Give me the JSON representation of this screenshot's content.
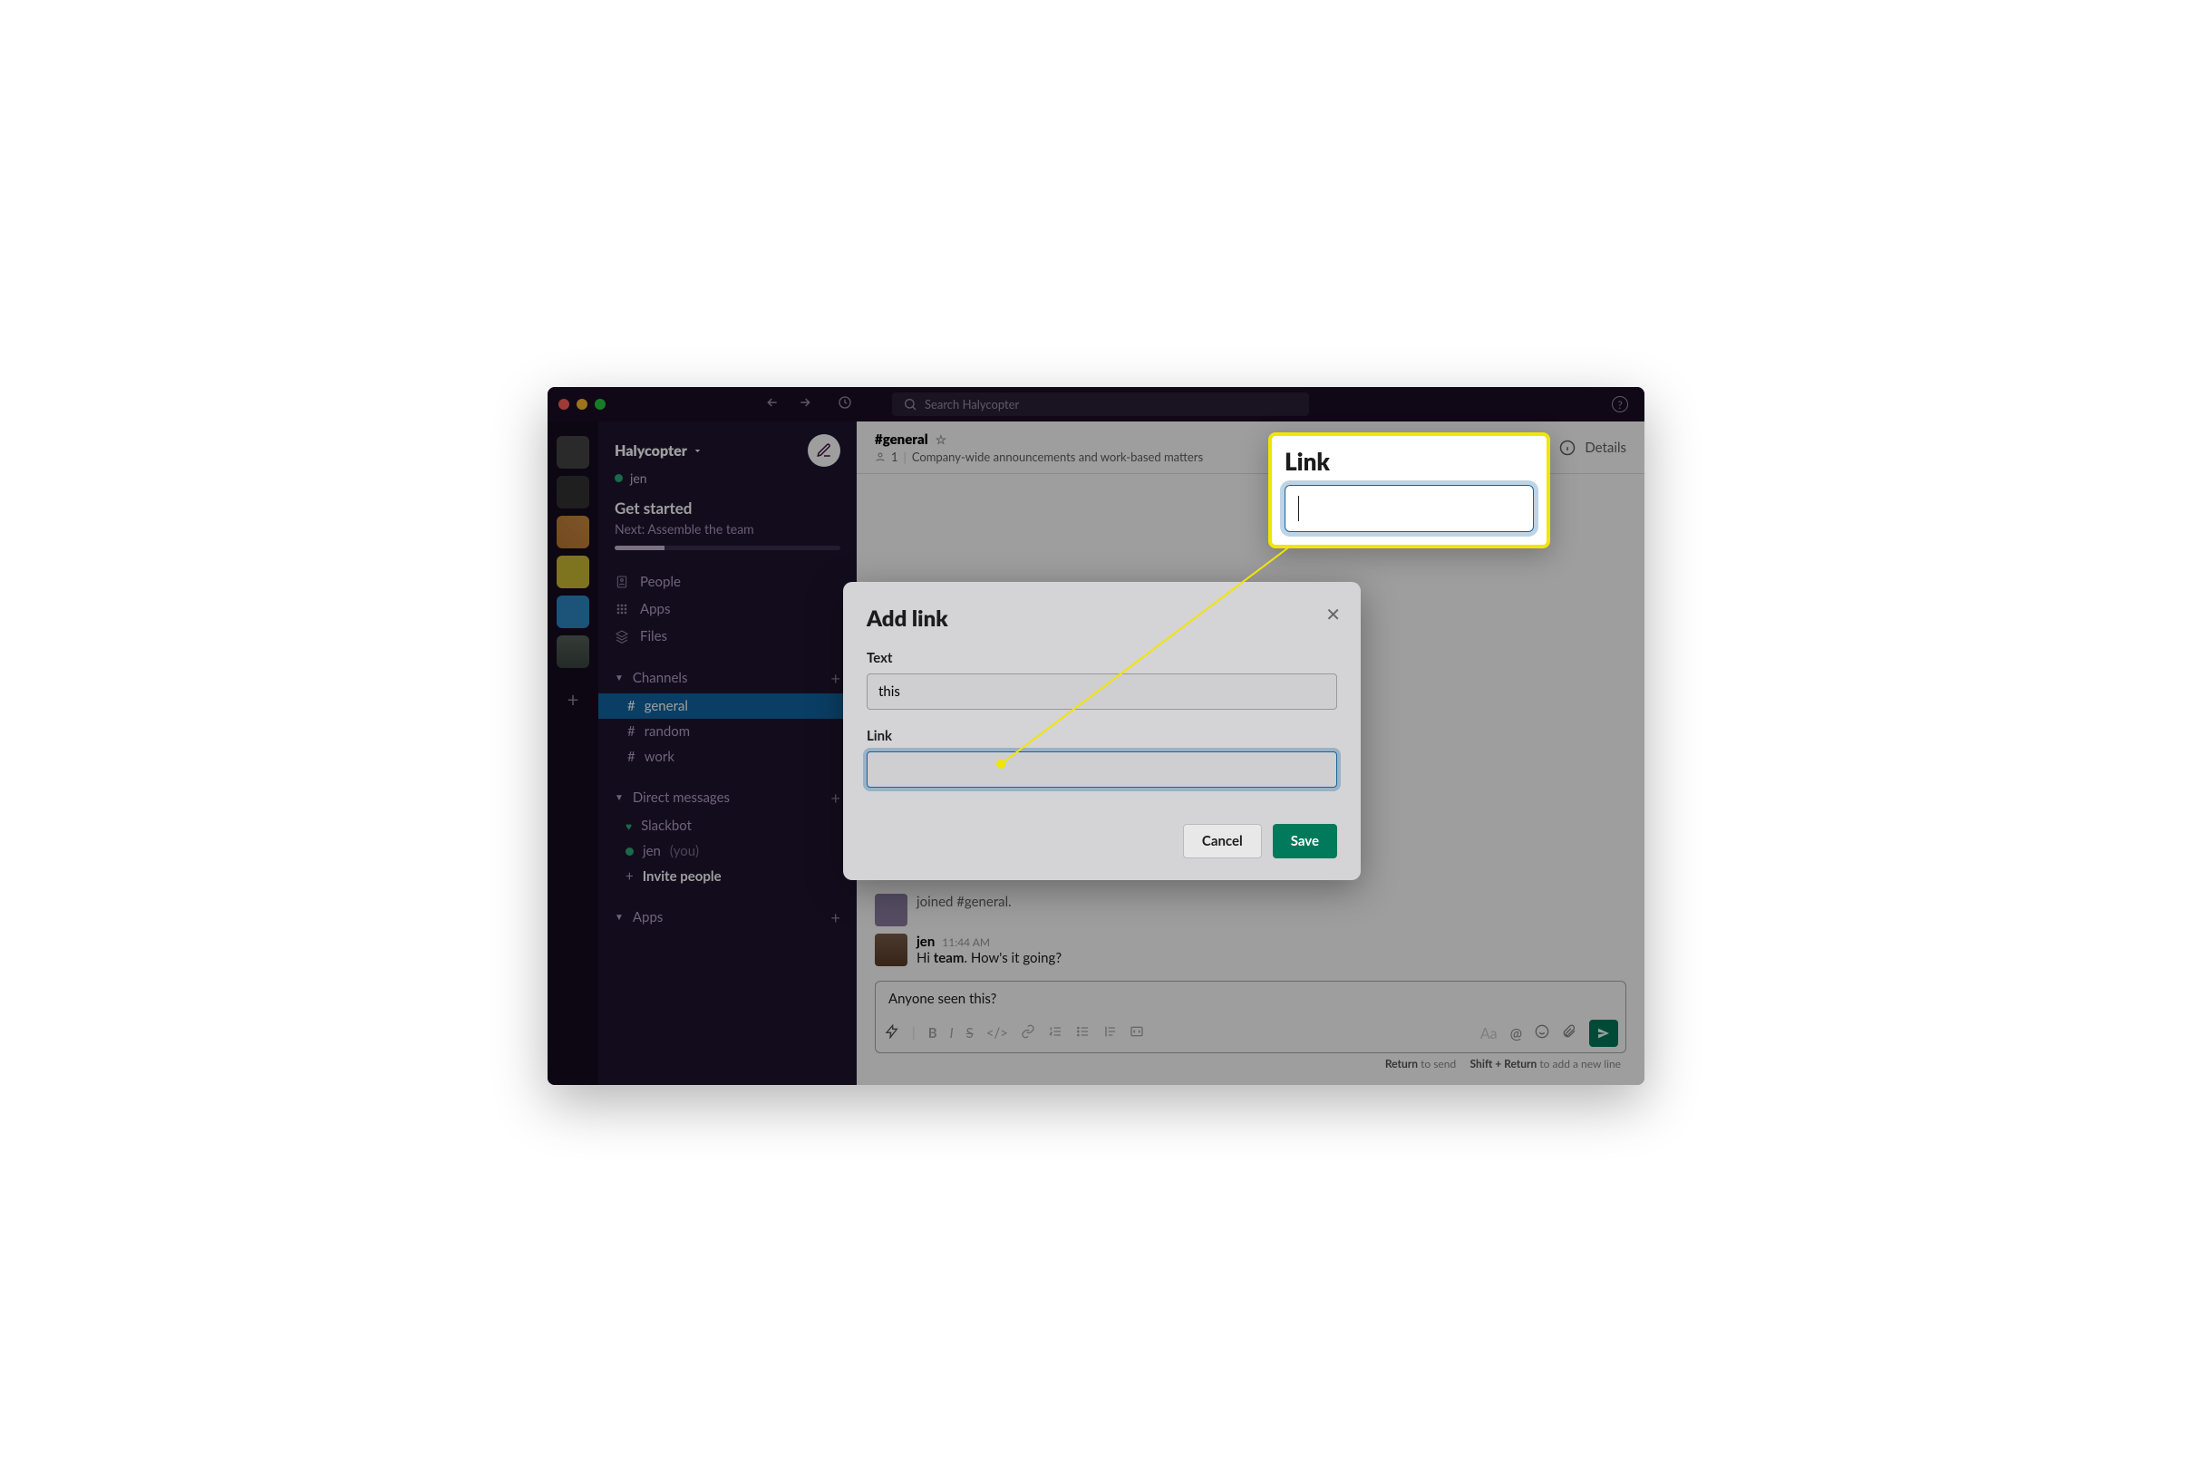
{
  "search_placeholder": "Search Halycopter",
  "sidebar": {
    "team_name": "Halycopter",
    "user_name": "jen",
    "onboard_title": "Get started",
    "onboard_sub": "Next: Assemble the team",
    "nav_people": "People",
    "nav_apps": "Apps",
    "nav_files": "Files",
    "section_channels": "Channels",
    "ch_general": "general",
    "ch_random": "random",
    "ch_work": "work",
    "section_dm": "Direct messages",
    "dm_slackbot": "Slackbot",
    "dm_jen": "jen",
    "dm_you": "(you)",
    "invite": "Invite people",
    "section_apps": "Apps"
  },
  "header": {
    "channel_name": "#general",
    "member_count": "1",
    "topic": "Company-wide announcements and work-based matters",
    "details": "Details"
  },
  "messages": {
    "joined_text": "joined #general.",
    "m1_name": "jen",
    "m1_time": "11:44 AM",
    "m1_text_pre": "Hi ",
    "m1_text_bold": "team",
    "m1_text_post": ". How's it going?"
  },
  "composer": {
    "draft": "Anyone seen this?",
    "hint_return": "Return",
    "hint_send": " to send",
    "hint_shift": "Shift + Return",
    "hint_newline": " to add a new line"
  },
  "modal": {
    "title": "Add link",
    "text_label": "Text",
    "text_value": "this",
    "link_label": "Link",
    "link_value": "",
    "cancel": "Cancel",
    "save": "Save"
  },
  "callout": {
    "title": "Link"
  }
}
